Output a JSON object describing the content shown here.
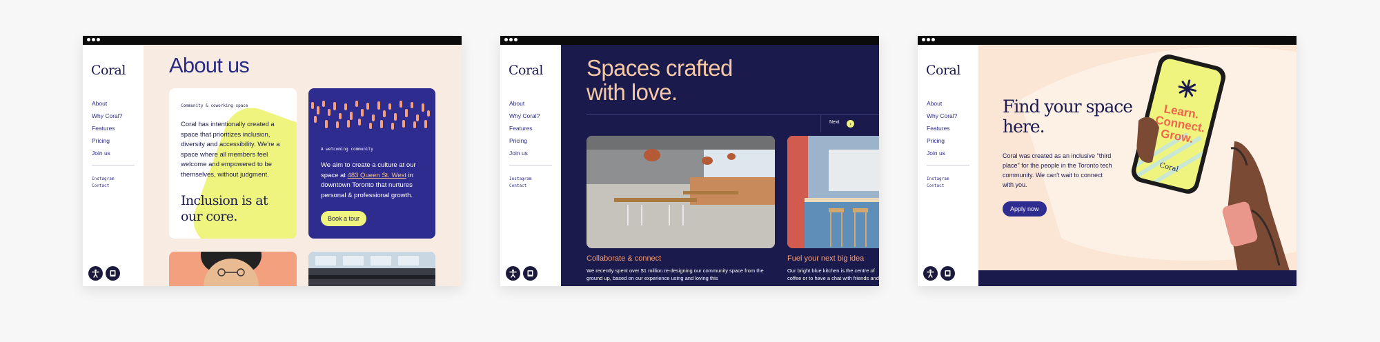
{
  "brand": {
    "logo": "Coral"
  },
  "nav": [
    "About",
    "Why Coral?",
    "Features",
    "Pricing",
    "Join us"
  ],
  "social": [
    "Instagram",
    "Contact"
  ],
  "accessibility": {
    "a11y_icon": "accessibility-icon",
    "book_icon": "book-icon"
  },
  "window1": {
    "title": "About us",
    "card_a": {
      "label": "Community & coworking space",
      "body": "Coral has intentionally created a space that prioritizes inclusion, diversity and accessibility. We're a space where all members feel welcome and empowered to be themselves, without judgment.",
      "headline": "Inclusion is at our core."
    },
    "card_b": {
      "label": "A welcoming community",
      "body_pre": "We aim to create a culture at our space at ",
      "address": "483 Queen St. West",
      "body_post": " in downtown Toronto that nurtures personal & professional growth.",
      "button": "Book a tour"
    }
  },
  "window2": {
    "title": "Spaces crafted with love.",
    "next_label": "Next",
    "items": [
      {
        "title": "Collaborate & connect",
        "text": "We recently spent over $1 million re-designing our community space from the ground up, based on our experience using and loving this"
      },
      {
        "title": "Fuel your next big idea",
        "text": "Our bright blue kitchen is the centre of coffee or to have a chat with friends and"
      }
    ]
  },
  "window3": {
    "title": "Find your space here.",
    "body": "Coral was created as an inclusive \"third place\" for the people in the Toronto tech community. We can't wait to connect with you.",
    "button": "Apply now",
    "phone_text": "Learn. Connect. Grow.",
    "phone_logo": "Coral"
  },
  "colors": {
    "navy": "#1a1a4c",
    "indigo": "#2f2c8f",
    "lime": "#eef47d",
    "peach": "#f5c9a6",
    "coral": "#f5a07b",
    "cream": "#f8ece2"
  }
}
